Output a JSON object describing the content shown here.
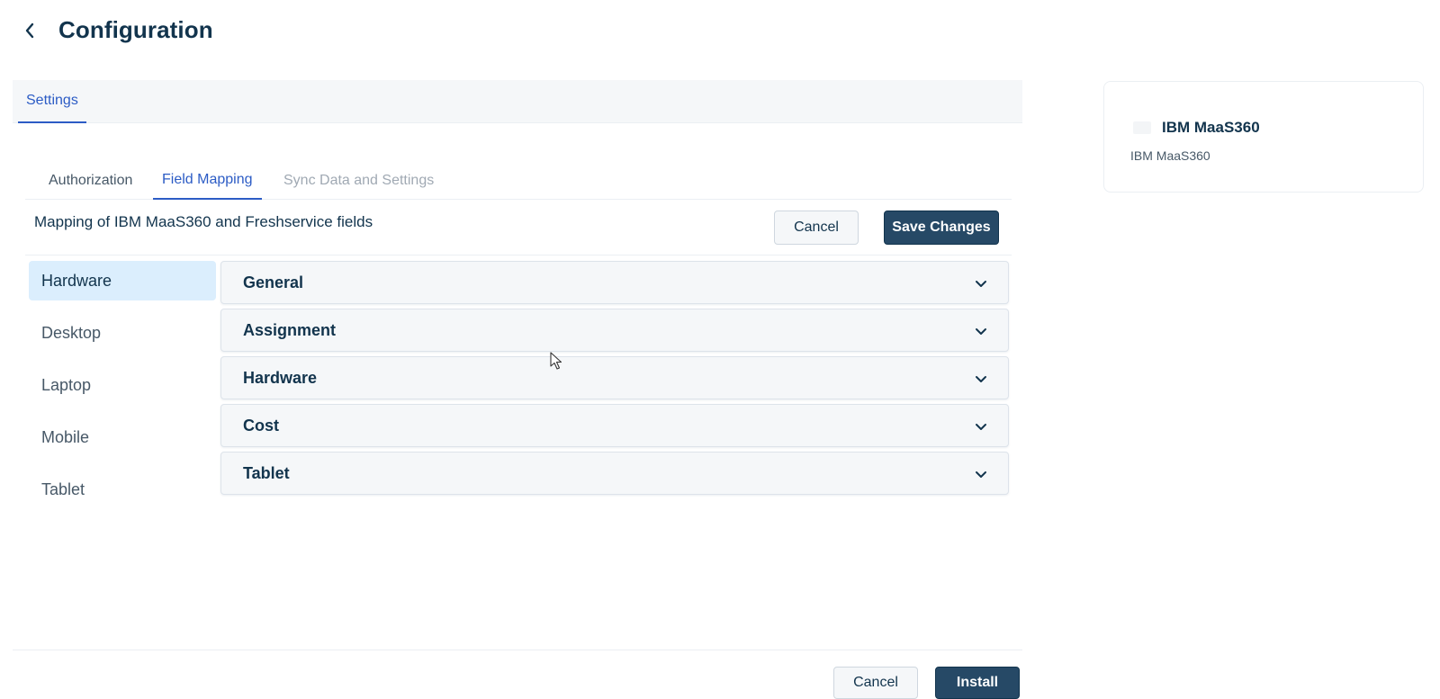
{
  "header": {
    "title": "Configuration"
  },
  "settings_tab": {
    "label": "Settings"
  },
  "subtabs": [
    {
      "label": "Authorization",
      "state": "normal"
    },
    {
      "label": "Field Mapping",
      "state": "active"
    },
    {
      "label": "Sync Data and Settings",
      "state": "disabled"
    }
  ],
  "mapping": {
    "title": "Mapping of IBM MaaS360 and Freshservice fields",
    "cancel_label": "Cancel",
    "save_label": "Save Changes"
  },
  "side_nav": {
    "items": [
      {
        "label": "Hardware",
        "active": true
      },
      {
        "label": "Desktop",
        "active": false
      },
      {
        "label": "Laptop",
        "active": false
      },
      {
        "label": "Mobile",
        "active": false
      },
      {
        "label": "Tablet",
        "active": false
      }
    ]
  },
  "sections": [
    {
      "label": "General"
    },
    {
      "label": "Assignment"
    },
    {
      "label": "Hardware"
    },
    {
      "label": "Cost"
    },
    {
      "label": "Tablet"
    }
  ],
  "footer": {
    "cancel_label": "Cancel",
    "install_label": "Install"
  },
  "app_card": {
    "name": "IBM MaaS360",
    "subtitle": "IBM MaaS360"
  },
  "colors": {
    "accent": "#2c5cc5",
    "primary_button": "#264966",
    "text": "#12344d",
    "active_nav_bg": "#dbeefd"
  },
  "icons": {
    "back": "chevron-left-icon",
    "expand": "chevron-down-icon",
    "app_logo": "app-logo-icon"
  }
}
